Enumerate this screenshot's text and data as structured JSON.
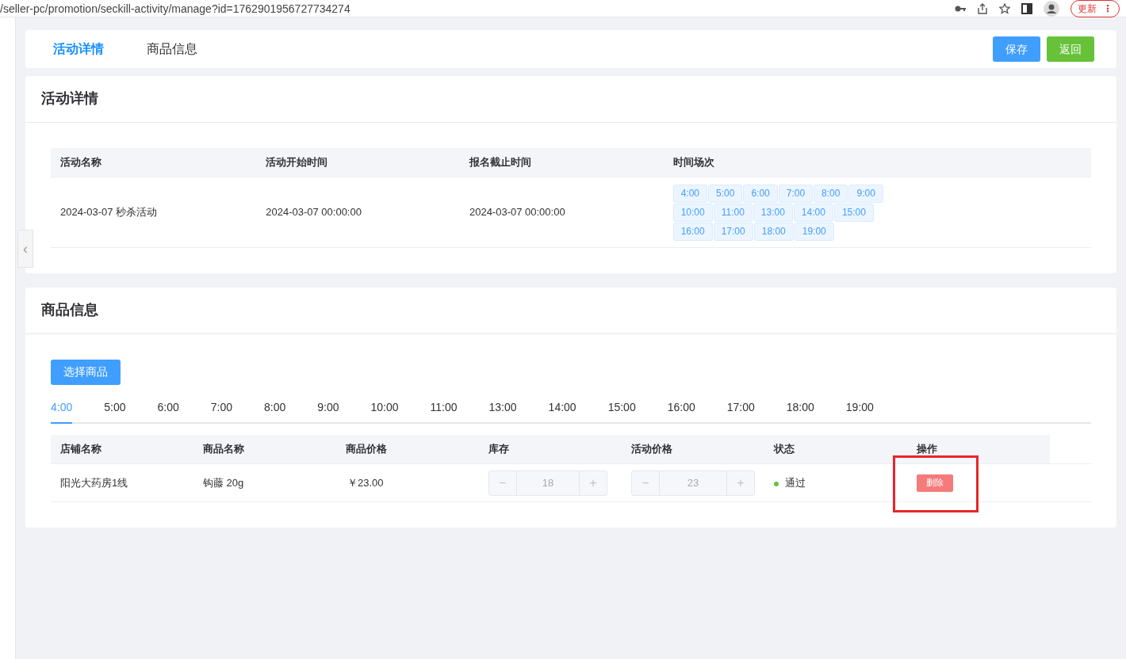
{
  "browser": {
    "url": "/seller-pc/promotion/seckill-activity/manage?id=1762901956727734274",
    "update_button": "更新",
    "menu_glyph": "⋮"
  },
  "tabs": [
    {
      "label": "活动详情",
      "selected": true
    },
    {
      "label": "商品信息",
      "selected": false
    }
  ],
  "buttons": [
    {
      "label": "保存",
      "kind": "primary"
    },
    {
      "label": "返回",
      "kind": "success"
    }
  ],
  "sidebar": {
    "collapse_glyph": "‹"
  },
  "activity": {
    "title": "活动详情",
    "columns": [
      "活动名称",
      "活动开始时间",
      "报名截止时间",
      "时间场次"
    ],
    "row": {
      "name": "2024-03-07 秒杀活动",
      "start": "2024-03-07 00:00:00",
      "deadline": "2024-03-07 00:00:00",
      "slots": [
        "4:00",
        "5:00",
        "6:00",
        "7:00",
        "8:00",
        "9:00",
        "10:00",
        "11:00",
        "13:00",
        "14:00",
        "15:00",
        "16:00",
        "17:00",
        "18:00",
        "19:00"
      ]
    }
  },
  "goods": {
    "title": "商品信息",
    "select_button": "选择商品",
    "time_tabs": [
      {
        "label": "4:00",
        "selected": true
      },
      {
        "label": "5:00",
        "selected": false
      },
      {
        "label": "6:00",
        "selected": false
      },
      {
        "label": "7:00",
        "selected": false
      },
      {
        "label": "8:00",
        "selected": false
      },
      {
        "label": "9:00",
        "selected": false
      },
      {
        "label": "10:00",
        "selected": false
      },
      {
        "label": "11:00",
        "selected": false
      },
      {
        "label": "13:00",
        "selected": false
      },
      {
        "label": "14:00",
        "selected": false
      },
      {
        "label": "15:00",
        "selected": false
      },
      {
        "label": "16:00",
        "selected": false
      },
      {
        "label": "17:00",
        "selected": false
      },
      {
        "label": "18:00",
        "selected": false
      },
      {
        "label": "19:00",
        "selected": false
      }
    ],
    "columns": [
      "店铺名称",
      "商品名称",
      "商品价格",
      "库存",
      "活动价格",
      "状态",
      "操作"
    ],
    "rows": [
      {
        "shop": "阳光大药房1线",
        "product": "钩藤 20g",
        "price": "￥23.00",
        "stock": {
          "value": "18",
          "minus": "−",
          "plus": "+",
          "disabled": true
        },
        "activity_price": {
          "value": "23",
          "minus": "−",
          "plus": "+",
          "disabled": true
        },
        "status": {
          "label": "通过",
          "color": "#67c23a"
        },
        "action": "删除",
        "highlighted": true
      }
    ]
  }
}
